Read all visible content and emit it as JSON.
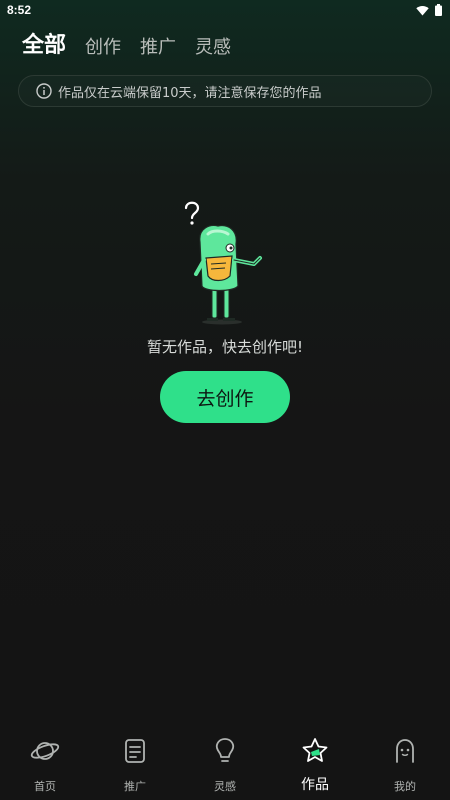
{
  "status_bar": {
    "time": "8:52",
    "icons": [
      "wifi-icon",
      "battery-icon"
    ]
  },
  "tabs": [
    {
      "label": "全部",
      "active": true
    },
    {
      "label": "创作",
      "active": false
    },
    {
      "label": "推广",
      "active": false
    },
    {
      "label": "灵感",
      "active": false
    }
  ],
  "notice": {
    "icon": "info-icon",
    "text": "作品仅在云端保留10天，请注意保存您的作品"
  },
  "empty_state": {
    "illustration": "confused-character-illustration",
    "message": "暂无作品，快去创作吧!",
    "button_label": "去创作"
  },
  "bottom_nav": [
    {
      "label": "首页",
      "icon": "planet-icon",
      "active": false
    },
    {
      "label": "推广",
      "icon": "document-icon",
      "active": false
    },
    {
      "label": "灵感",
      "icon": "lightbulb-icon",
      "active": false
    },
    {
      "label": "作品",
      "icon": "star-icon",
      "active": true
    },
    {
      "label": "我的",
      "icon": "profile-icon",
      "active": false
    }
  ],
  "colors": {
    "accent": "#2fe08a",
    "background": "#141414",
    "text_muted": "#b0b3b1"
  }
}
